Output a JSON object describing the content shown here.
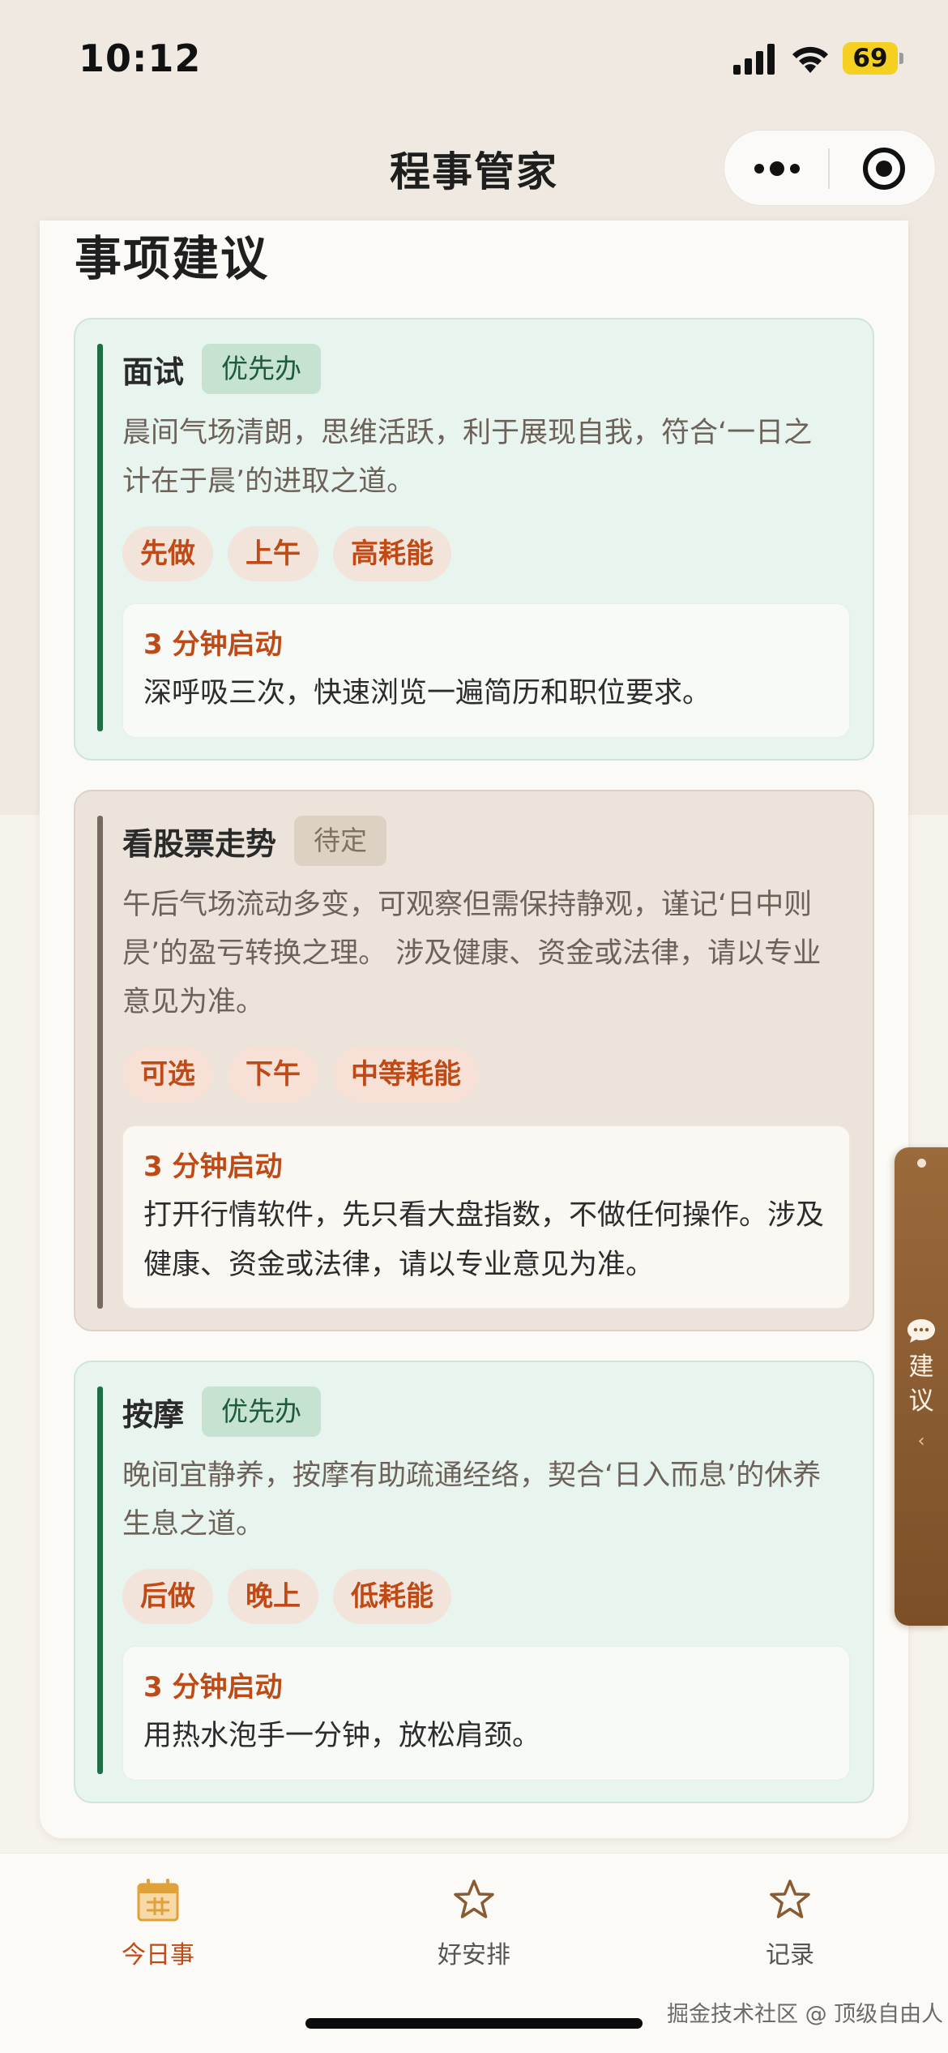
{
  "status": {
    "time": "10:12",
    "battery": "69"
  },
  "header": {
    "title": "程事管家"
  },
  "section": {
    "title": "事项建议"
  },
  "cards": [
    {
      "title": "面试",
      "badge": "优先办",
      "desc": "晨间气场清朗，思维活跃，利于展现自我，符合‘一日之计在于晨’的进取之道。",
      "tags": [
        "先做",
        "上午",
        "高耗能"
      ],
      "tip_title": "3 分钟启动",
      "tip_text": "深呼吸三次，快速浏览一遍简历和职位要求。"
    },
    {
      "title": "看股票走势",
      "badge": "待定",
      "desc": "午后气场流动多变，可观察但需保持静观，谨记‘日中则昃’的盈亏转换之理。 涉及健康、资金或法律，请以专业意见为准。",
      "tags": [
        "可选",
        "下午",
        "中等耗能"
      ],
      "tip_title": "3 分钟启动",
      "tip_text": "打开行情软件，先只看大盘指数，不做任何操作。涉及健康、资金或法律，请以专业意见为准。"
    },
    {
      "title": "按摩",
      "badge": "优先办",
      "desc": "晚间宜静养，按摩有助疏通经络，契合‘日入而息’的休养生息之道。",
      "tags": [
        "后做",
        "晚上",
        "低耗能"
      ],
      "tip_title": "3 分钟启动",
      "tip_text": "用热水泡手一分钟，放松肩颈。"
    }
  ],
  "side_tab": {
    "label_1": "建",
    "label_2": "议",
    "arrow": "‹"
  },
  "tabbar": {
    "today": "今日事",
    "arrange": "好安排",
    "records": "记录"
  },
  "watermark": "掘金技术社区 @ 顶级自由人",
  "colors": {
    "accent": "#c04a16",
    "priority_bar": "#1f6e45",
    "side_tab": "#8a5a30"
  }
}
